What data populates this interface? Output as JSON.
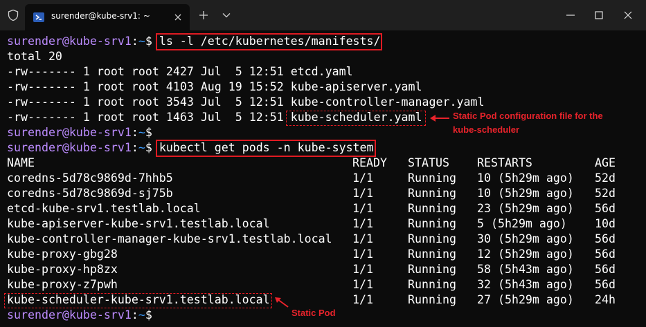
{
  "titlebar": {
    "tab_title": "surender@kube-srv1: ~"
  },
  "prompt": {
    "user": "surender@kube-srv1",
    "sep": ":",
    "path": "~",
    "dollar": "$"
  },
  "commands": {
    "ls": "ls -l /etc/kubernetes/manifests/",
    "kubectl": "kubectl get pods -n kube-system"
  },
  "ls_output": {
    "total": "total 20",
    "files": [
      {
        "perm": "-rw-------",
        "links": "1",
        "owner": "root",
        "group": "root",
        "size": "2427",
        "date": "Jul  5 12:51",
        "name": "etcd.yaml"
      },
      {
        "perm": "-rw-------",
        "links": "1",
        "owner": "root",
        "group": "root",
        "size": "4103",
        "date": "Aug 19 15:52",
        "name": "kube-apiserver.yaml"
      },
      {
        "perm": "-rw-------",
        "links": "1",
        "owner": "root",
        "group": "root",
        "size": "3543",
        "date": "Jul  5 12:51",
        "name": "kube-controller-manager.yaml"
      },
      {
        "perm": "-rw-------",
        "links": "1",
        "owner": "root",
        "group": "root",
        "size": "1463",
        "date": "Jul  5 12:51",
        "name": "kube-scheduler.yaml"
      }
    ]
  },
  "pods_table": {
    "headers": [
      "NAME",
      "READY",
      "STATUS",
      "RESTARTS",
      "AGE"
    ],
    "rows": [
      [
        "coredns-5d78c9869d-7hhb5",
        "1/1",
        "Running",
        "10 (5h29m ago)",
        "52d"
      ],
      [
        "coredns-5d78c9869d-sj75b",
        "1/1",
        "Running",
        "10 (5h29m ago)",
        "52d"
      ],
      [
        "etcd-kube-srv1.testlab.local",
        "1/1",
        "Running",
        "23 (5h29m ago)",
        "56d"
      ],
      [
        "kube-apiserver-kube-srv1.testlab.local",
        "1/1",
        "Running",
        "5 (5h29m ago)",
        "10d"
      ],
      [
        "kube-controller-manager-kube-srv1.testlab.local",
        "1/1",
        "Running",
        "30 (5h29m ago)",
        "56d"
      ],
      [
        "kube-proxy-gbg28",
        "1/1",
        "Running",
        "12 (5h29m ago)",
        "56d"
      ],
      [
        "kube-proxy-hp8zx",
        "1/1",
        "Running",
        "58 (5h43m ago)",
        "56d"
      ],
      [
        "kube-proxy-z7pwh",
        "1/1",
        "Running",
        "32 (5h43m ago)",
        "56d"
      ],
      [
        "kube-scheduler-kube-srv1.testlab.local",
        "1/1",
        "Running",
        "27 (5h29m ago)",
        "24h"
      ]
    ]
  },
  "annotations": {
    "static_pod_config_line1": "Static Pod configuration file for the",
    "static_pod_config_line2": "kube-scheduler",
    "static_pod": "Static Pod"
  },
  "colors": {
    "background": "#0c0c0c",
    "titlebar": "#1f1f1f",
    "prompt_user": "#bc8cff",
    "prompt_path": "#3b9cff",
    "highlight": "#e01a22"
  }
}
